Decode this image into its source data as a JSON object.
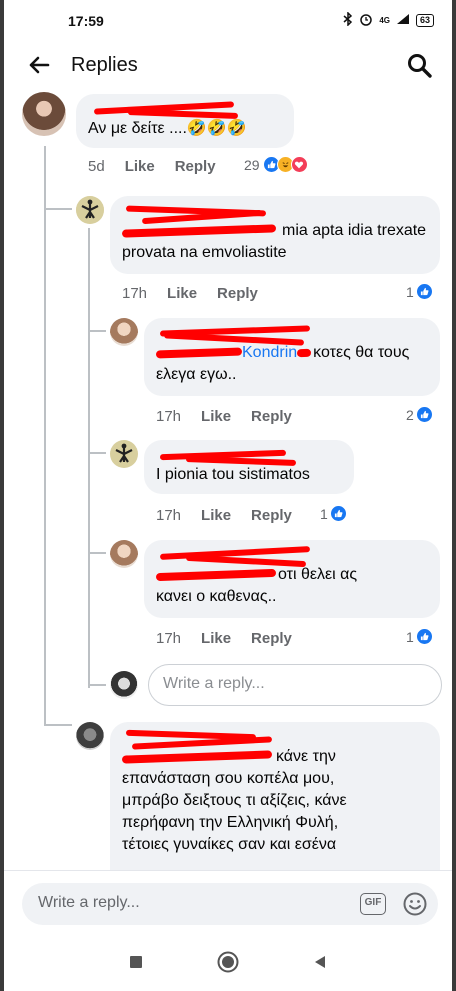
{
  "status_bar": {
    "time": "17:59",
    "icons": [
      "bluetooth-icon",
      "alarm-icon",
      "signal-4g-icon",
      "wifi-icon",
      "battery-icon"
    ],
    "battery": "63",
    "network": "4G"
  },
  "header": {
    "title": "Replies"
  },
  "comments": [
    {
      "text": "Αν με δείτε ....🤣🤣🤣",
      "time": "5d",
      "like": "Like",
      "reply": "Reply",
      "reaction_count": "29"
    },
    {
      "text": "mia apta idia trexate provata na emvoliastite",
      "time": "17h",
      "like": "Like",
      "reply": "Reply",
      "reaction_count": "1"
    },
    {
      "text_suffix": "κοτες θα τους",
      "text_line2": "ελεγα εγω..",
      "mention_tail": "Kondrin",
      "time": "17h",
      "like": "Like",
      "reply": "Reply",
      "reaction_count": "2"
    },
    {
      "text": "I pionia tou sistimatos",
      "time": "17h",
      "like": "Like",
      "reply": "Reply",
      "reaction_count": "1"
    },
    {
      "text_suffix": "οτι θελει ας",
      "text_line2": "κανει ο καθενας..",
      "time": "17h",
      "like": "Like",
      "reply": "Reply",
      "reaction_count": "1"
    },
    {
      "text_suffix": "κάνε την",
      "text_lines": [
        "επανάσταση σου κοπέλα μου,",
        "μπράβο δειξτους τι αξίζεις, κάνε",
        "περήφανη την Ελληνική Φυλή,",
        "τέτοιες γυναίκες σαν και εσένα"
      ]
    }
  ],
  "inline_reply": {
    "placeholder": "Write a reply..."
  },
  "composer": {
    "placeholder": "Write a reply...",
    "gif_label": "GIF"
  },
  "colors": {
    "accent": "#1877f2",
    "bubble": "#f0f2f5",
    "meta": "#65676b",
    "redaction": "#ff0000"
  }
}
